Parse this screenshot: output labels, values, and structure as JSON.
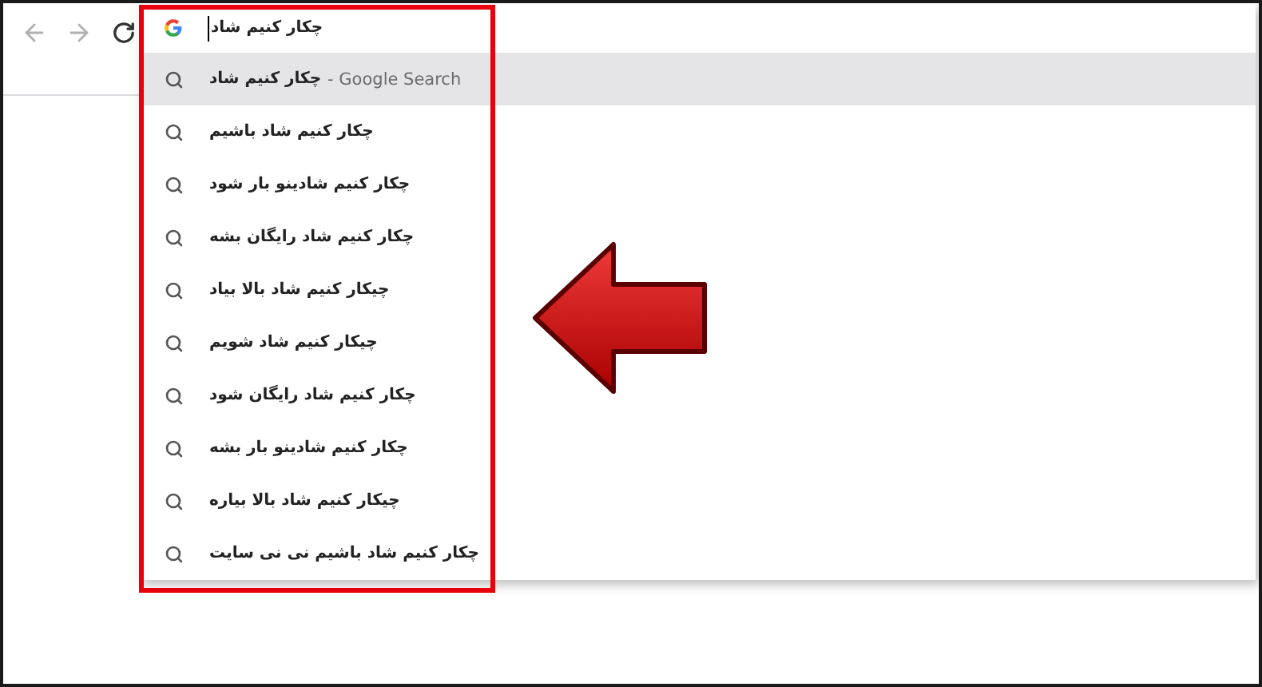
{
  "omnibox": {
    "value": "چکار کنیم شاد"
  },
  "suggestions": [
    {
      "text": "چکار کنیم شاد",
      "suffix": "- Google Search",
      "selected": true
    },
    {
      "text": "چکار کنیم شاد باشیم",
      "selected": false
    },
    {
      "text": "چکار کنیم شادینو بار شود",
      "selected": false
    },
    {
      "text": "چکار کنیم شاد رایگان بشه",
      "selected": false
    },
    {
      "text": "چیکار کنیم شاد بالا بیاد",
      "selected": false
    },
    {
      "text": "چیکار کنیم شاد شویم",
      "selected": false
    },
    {
      "text": "چکار کنیم شاد رایگان شود",
      "selected": false
    },
    {
      "text": "چکار کنیم شادینو بار بشه",
      "selected": false
    },
    {
      "text": "چیکار کنیم شاد بالا بیاره",
      "selected": false
    },
    {
      "text": "چکار کنیم شاد باشیم نی نی سایت",
      "selected": false
    }
  ]
}
